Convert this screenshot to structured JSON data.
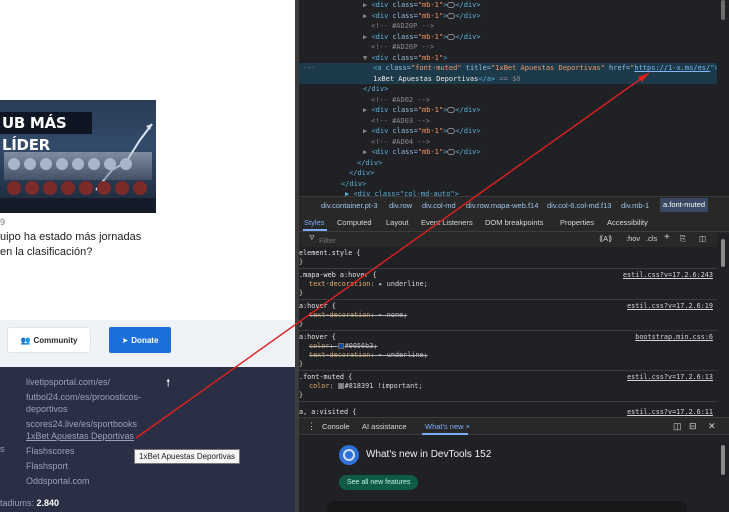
{
  "site": {
    "thumb_title": "UB MÁS LÍDER",
    "article_date": "9",
    "article_title_line1": "uipo ha estado más jornadas",
    "article_title_line2": "en la clasificación?",
    "community_label": "Community",
    "donate_label": "Donate",
    "footer_links": [
      "livetipsportal.com/es/",
      "futbol24.com/es/pronosticos-",
      "deportivos",
      "scores24.live/es/sportbooks",
      "1xBet Apuestas Deportivas",
      "Flashscores",
      "Flashsport",
      "Oddsportal.com"
    ],
    "edge_letter": "s",
    "tooltip": "1xBet Apuestas Deportivas",
    "stats_label": "tadiums:",
    "stats_value": "2.840",
    "scroll_up_icon": "arrow-up-icon"
  },
  "devtools": {
    "elements_lines": [
      {
        "type": "div",
        "arrow": "▶",
        "text_tag": "<div ",
        "attr": "class=",
        "val": "\"mb-1\"",
        "close": ">",
        "ell": true,
        "end": "</div>"
      },
      {
        "type": "div",
        "arrow": "▶",
        "text_tag": "<div ",
        "attr": "class=",
        "val": "\"mb-1\"",
        "close": ">",
        "ell": true,
        "end": "</div>"
      },
      {
        "type": "comment",
        "text": "<!-- #AD20P -->"
      },
      {
        "type": "div",
        "arrow": "▶",
        "text_tag": "<div ",
        "attr": "class=",
        "val": "\"mb-1\"",
        "close": ">",
        "ell": true,
        "end": "</div>"
      },
      {
        "type": "comment",
        "text": "<!-- #AD26P -->"
      },
      {
        "type": "div",
        "arrow": "▼",
        "text_tag": "<div ",
        "attr": "class=",
        "val": "\"mb-1\"",
        "close": ">",
        "ell": false,
        "end": ""
      }
    ],
    "anchor_line1": {
      "tag": "<a ",
      "a1": "class=",
      "v1": "\"font-muted\"",
      "a2": " title=",
      "v2": "\"1xBet Apuestas Deportivas\"",
      "a3": " href=",
      "v3": "https://1-x.ms/es/",
      "close": "\">"
    },
    "anchor_line2": {
      "text": "1xBet Apuestas Deportivas",
      "end": "</a>",
      "eq": "== $0"
    },
    "elements_tail": [
      {
        "type": "close",
        "text": "</div>"
      },
      {
        "type": "comment",
        "text": "<!-- #AD02 -->"
      },
      {
        "type": "div",
        "arrow": "▶",
        "text_tag": "<div ",
        "attr": "class=",
        "val": "\"mb-1\"",
        "close": ">",
        "ell": true,
        "end": "</div>"
      },
      {
        "type": "comment",
        "text": "<!-- #AD03 -->"
      },
      {
        "type": "div",
        "arrow": "▶",
        "text_tag": "<div ",
        "attr": "class=",
        "val": "\"mb-1\"",
        "close": ">",
        "ell": true,
        "end": "</div>"
      },
      {
        "type": "comment",
        "text": "<!-- #AD04 -->"
      },
      {
        "type": "div",
        "arrow": "▶",
        "text_tag": "<div ",
        "attr": "class=",
        "val": "\"mb-1\"",
        "close": ">",
        "ell": true,
        "end": "</div>"
      },
      {
        "type": "close",
        "text": "</div>"
      },
      {
        "type": "close",
        "text": "</div>"
      },
      {
        "type": "close",
        "text": "</div>"
      }
    ],
    "partial_line": "<div class=\"col-md-auto\">",
    "breadcrumbs": [
      "div.container.pt-3",
      "div.row",
      "div.col-md",
      "div.row.mapa-web.f14",
      "div.col-6.col-md.f13",
      "div.mb-1",
      "a.font-muted"
    ],
    "tabs": [
      "Styles",
      "Computed",
      "Layout",
      "Event Listeners",
      "DOM breakpoints",
      "Properties",
      "Accessibility"
    ],
    "filter_placeholder": "Filter",
    "filter_tools": [
      ":hov",
      ".cls",
      "+"
    ],
    "styles_rules": {
      "element_style": "element.style {",
      "r1_sel": ".mapa-web a:hover {",
      "r1_src": "estil.css?v=17.2.6:243",
      "r1_prop": "text-decoration",
      "r1_val": "underline;",
      "r2_sel": "a:hover {",
      "r2_src": "estil.css?v=17.2.6:19",
      "r2_prop": "text-decoration",
      "r2_val": "none;",
      "r3_sel": "a:hover {",
      "r3_src": "bootstrap.min.css:6",
      "r3_p1": "color",
      "r3_v1": "#0056b3;",
      "r3_p2": "text-decoration",
      "r3_v2": "underline;",
      "r4_sel": ".font-muted {",
      "r4_src": "estil.css?v=17.2.6:13",
      "r4_prop": "color",
      "r4_val": "#818391 !important;",
      "r5_sel": "a, a:visited {",
      "r5_src": "estil.css?v=17.2.6:11",
      "brace": "}",
      "colon": ": ",
      "triangle": "▶"
    },
    "drawer_tabs": [
      "Console",
      "AI assistance",
      "What's new"
    ],
    "whats_new_title": "What's new in DevTools 152",
    "whats_new_button": "See all new features"
  },
  "colors": {
    "footer_bg": "#2b2f45",
    "donate_blue": "#1c6ed8",
    "link_blue": "#0056b3",
    "muted": "#818391",
    "arrow_red": "#e02020"
  }
}
